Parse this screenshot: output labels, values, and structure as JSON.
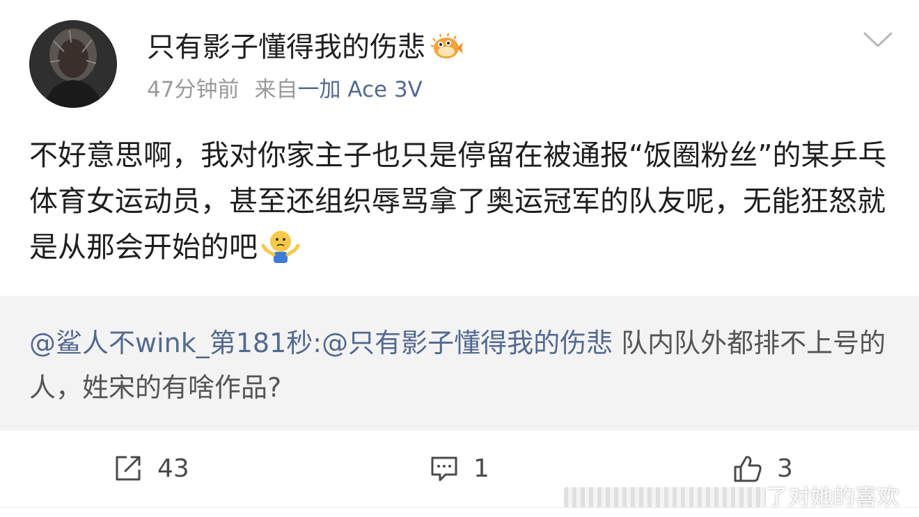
{
  "post": {
    "username": "只有影子懂得我的伤悲",
    "time": "47分钟前",
    "from_label": "来自",
    "source": "一加 Ace 3V",
    "text": "不好意思啊，我对你家主子也只是停留在被通报“饭圈粉丝”的某乒乓体育女运动员，甚至还组织辱骂拿了奥运冠军的队友呢，无能狂怒就是从那会开始的吧"
  },
  "quote": {
    "mention_1": "@鲨人不wink_第181秒",
    "separator": ":",
    "mention_2": "@只有影子懂得我的伤悲",
    "text": " 队内队外都排不上号的人，姓宋的有啥作品?"
  },
  "actions": {
    "repost_count": "43",
    "comment_count": "1",
    "like_count": "3"
  },
  "watermark": "了对她的喜欢",
  "colors": {
    "link": "#53698f",
    "quote_bg": "#f3f3f3",
    "meta": "#9a9a9a"
  }
}
